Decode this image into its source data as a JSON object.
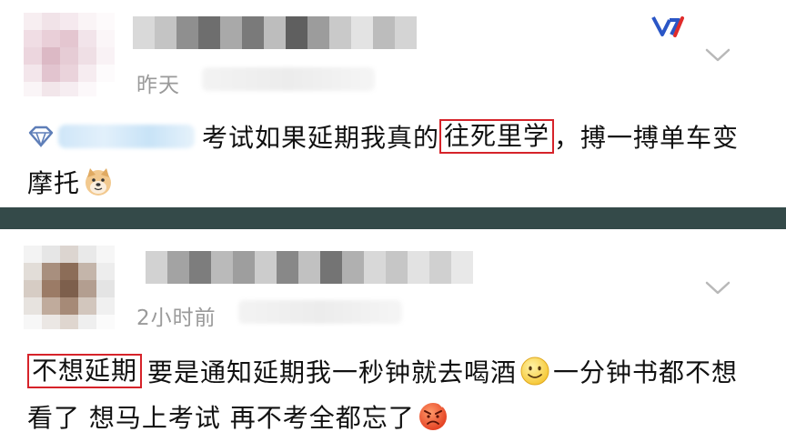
{
  "post1": {
    "timestamp": "昨天",
    "text_a": "考试如果延期我真的",
    "highlight": "往死里学",
    "text_b": "，搏一搏单车变",
    "text_c": "摩托"
  },
  "post2": {
    "timestamp": "2小时前",
    "highlight": "不想延期",
    "text_a": "要是通知延期我一秒钟就去喝酒",
    "text_b": "一分钟书都不想",
    "text_c": "看了 想马上考试 再不考全都忘了"
  },
  "icons": {
    "avatar": "pixelated-avatar",
    "expand": "chevron-down-icon",
    "badge": "diamond-icon",
    "emoji_dog": "doge-emoji-icon",
    "emoji_smile": "smile-emoji-icon",
    "emoji_angry": "angry-emoji-icon",
    "watermark": "logo-icon"
  },
  "colors": {
    "highlight_border": "#d6232a",
    "divider": "#344a49",
    "timestamp": "#9a9a9a",
    "logo_blue": "#2a56c6",
    "logo_red": "#e02b2b"
  }
}
